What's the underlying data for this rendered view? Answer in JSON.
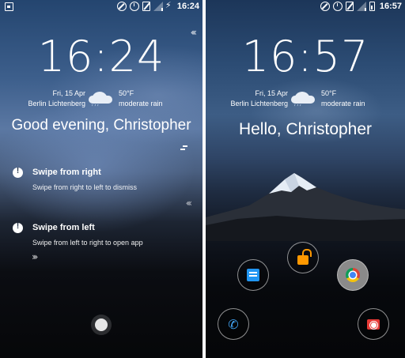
{
  "left_screen": {
    "status_time": "16:24",
    "clock": "16:24",
    "date": "Fri, 15 Apr",
    "location": "Berlin Lichtenberg",
    "temperature": "50°F",
    "condition": "moderate rain",
    "greeting": "Good evening, Christopher",
    "tips": [
      {
        "title": "Swipe from right",
        "text": "Swipe from right to left to dismiss"
      },
      {
        "title": "Swipe from left",
        "text": "Swipe from left to right to open app"
      }
    ],
    "chevrons_left": "‹‹‹",
    "chevrons_right": "›››"
  },
  "right_screen": {
    "status_time": "16:57",
    "clock": "16:57",
    "date": "Fri, 15 Apr",
    "location": "Berlin Lichtenberg",
    "temperature": "50°F",
    "condition": "moderate rain",
    "greeting": "Hello, Christopher",
    "apps": [
      "messages-icon",
      "unlock-icon",
      "chrome-icon",
      "phone-icon",
      "camera-icon"
    ]
  },
  "colors": {
    "chrome_bg": "#8a8a8a",
    "messages": "#2196f3",
    "unlock": "#ff9800",
    "phone": "#42a5f5",
    "camera": "#e53935"
  }
}
